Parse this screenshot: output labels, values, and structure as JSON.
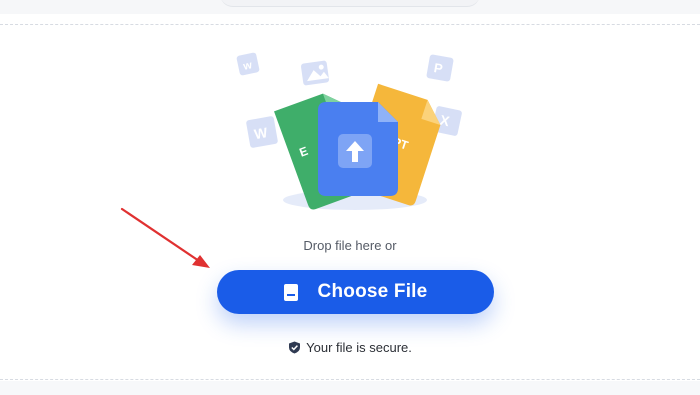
{
  "upload": {
    "drop_text": "Drop file here or",
    "button_label": "Choose File",
    "secure_text": "Your file is secure."
  },
  "illustration": {
    "card_green_label": "E",
    "card_orange_label": "PT",
    "floating_icons": [
      "word-icon",
      "image-icon",
      "powerpoint-icon",
      "excel-icon",
      "word-doc-icon"
    ]
  },
  "colors": {
    "button": "#1a5ce8",
    "card_blue": "#4a7ff0",
    "card_green": "#3fae6a",
    "card_orange": "#f5b73b",
    "arrow": "#e03131"
  }
}
